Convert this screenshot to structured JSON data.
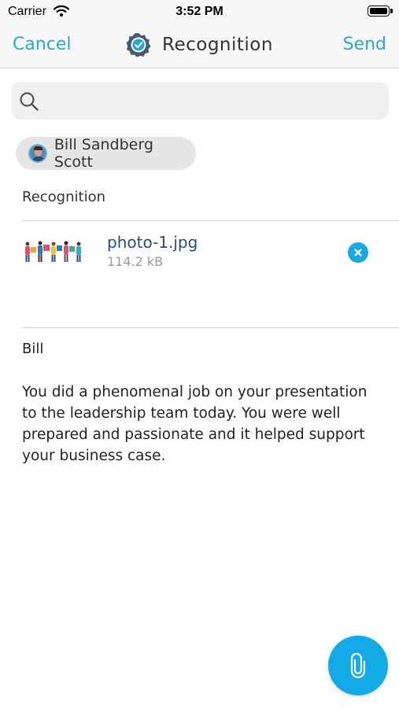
{
  "status_bar": {
    "carrier": "Carrier",
    "time": "3:52 PM"
  },
  "navbar": {
    "cancel_label": "Cancel",
    "title": "Recognition",
    "send_label": "Send",
    "badge_icon": "verified-badge-icon"
  },
  "search": {
    "placeholder": "",
    "value": "",
    "icon": "search-icon"
  },
  "recipient": {
    "name": "Bill Sandberg Scott",
    "avatar_icon": "avatar"
  },
  "section": {
    "label": "Recognition"
  },
  "attachment": {
    "file_name": "photo-1.jpg",
    "file_size": "114.2 kB",
    "remove_icon": "close-icon"
  },
  "message": {
    "greeting": "Bill",
    "body": "You did a phenomenal job on your presentation to the leadership team today.  You were well prepared and passionate and it helped support your business case."
  },
  "fab": {
    "icon": "paperclip-icon"
  },
  "colors": {
    "accent": "#2aa6d9",
    "fab": "#13aae8",
    "file_name": "#2b4b7e"
  }
}
